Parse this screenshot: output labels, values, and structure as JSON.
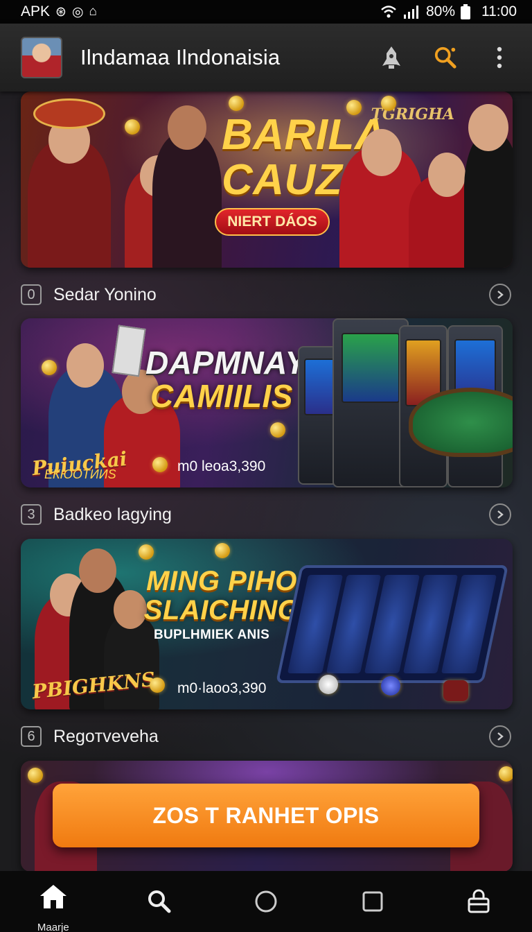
{
  "status_bar": {
    "left_text": "APK",
    "battery": "80%",
    "time": "11:00"
  },
  "app_bar": {
    "title": "Ilndamaa Ilndonaisia"
  },
  "banners": [
    {
      "line1": "BARILA",
      "line2": "CAUZS",
      "pill": "NIERT DÁOS",
      "brand": "TGRIGHA"
    },
    {
      "line1": "DAPMNAY",
      "line2": "CAMIILIS",
      "brand": "Puiuckai",
      "brand2": "ЕКЮОТИИЅ",
      "count": "m0 leoa3,390"
    },
    {
      "line1": "MING PIHO",
      "line2": "SLAICHING",
      "subtitle": "BUPLHMIEK ANIS",
      "brand": "PBIGHKNS",
      "count": "m0·laoo3,390"
    },
    {}
  ],
  "sections": [
    {
      "number": "0",
      "label": "Sedar Yonino"
    },
    {
      "number": "3",
      "label": "Badkeo lagying"
    },
    {
      "number": "6",
      "label": "Regoтveveha"
    }
  ],
  "cta": {
    "label": "ZOS T RANHET OPIS"
  },
  "bottom_nav": {
    "home_label": "Maarje"
  },
  "colors": {
    "accent": "#f0891e",
    "gold": "#ffd24a",
    "background": "#1c1c1e"
  }
}
